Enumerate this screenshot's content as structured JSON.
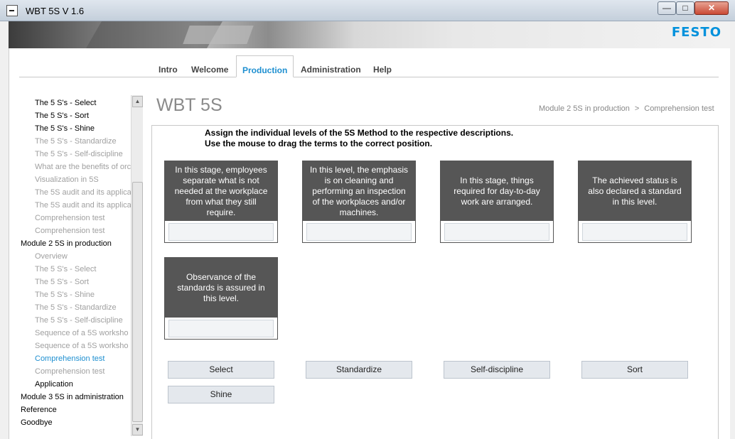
{
  "window": {
    "title": "WBT 5S  V 1.6",
    "minimize": "—",
    "maximize": "□",
    "close": "✕"
  },
  "banner": {
    "logo": "FESTO"
  },
  "tabs": [
    {
      "label": "Intro",
      "active": false
    },
    {
      "label": "Welcome",
      "active": false
    },
    {
      "label": "Production",
      "active": true
    },
    {
      "label": "Administration",
      "active": false
    },
    {
      "label": "Help",
      "active": false
    }
  ],
  "sidebar": {
    "items": [
      {
        "label": "The 5 S's - Select",
        "level": 1,
        "state": "dark"
      },
      {
        "label": "The 5 S's - Sort",
        "level": 1,
        "state": "dark"
      },
      {
        "label": "The 5 S's - Shine",
        "level": 1,
        "state": "dark"
      },
      {
        "label": "The 5 S's - Standardize",
        "level": 1,
        "state": "grey"
      },
      {
        "label": "The 5 S's - Self-discipline",
        "level": 1,
        "state": "grey"
      },
      {
        "label": "What are the benefits of orc",
        "level": 1,
        "state": "grey"
      },
      {
        "label": "Visualization in 5S",
        "level": 1,
        "state": "grey"
      },
      {
        "label": "The 5S audit and its applicat",
        "level": 1,
        "state": "grey"
      },
      {
        "label": "The 5S audit and its applicat",
        "level": 1,
        "state": "grey"
      },
      {
        "label": "Comprehension test",
        "level": 1,
        "state": "grey"
      },
      {
        "label": "Comprehension test",
        "level": 1,
        "state": "grey"
      },
      {
        "label": "Module 2 5S in production",
        "level": 0,
        "state": "dark"
      },
      {
        "label": "Overview",
        "level": 1,
        "state": "grey"
      },
      {
        "label": "The 5 S's - Select",
        "level": 1,
        "state": "grey"
      },
      {
        "label": "The 5 S's - Sort",
        "level": 1,
        "state": "grey"
      },
      {
        "label": "The 5 S's - Shine",
        "level": 1,
        "state": "grey"
      },
      {
        "label": "The 5 S's - Standardize",
        "level": 1,
        "state": "grey"
      },
      {
        "label": "The 5 S's - Self-discipline",
        "level": 1,
        "state": "grey"
      },
      {
        "label": "Sequence of a 5S worksho",
        "level": 1,
        "state": "grey"
      },
      {
        "label": "Sequence of a 5S worksho",
        "level": 1,
        "state": "grey"
      },
      {
        "label": "Comprehension test",
        "level": 1,
        "state": "blue"
      },
      {
        "label": "Comprehension test",
        "level": 1,
        "state": "grey"
      },
      {
        "label": "Application",
        "level": 1,
        "state": "dark"
      },
      {
        "label": "Module 3 5S in administration",
        "level": 0,
        "state": "dark"
      },
      {
        "label": "Reference",
        "level": 0,
        "state": "dark"
      },
      {
        "label": "Goodbye",
        "level": 0,
        "state": "dark"
      }
    ],
    "scroll_up": "▲",
    "scroll_down": "▼"
  },
  "main": {
    "title": "WBT 5S",
    "breadcrumb": [
      "Module 2 5S in production",
      "Comprehension test"
    ],
    "breadcrumb_sep": ">",
    "instructions": [
      "Assign the individual levels of the 5S Method to the respective descriptions.",
      "Use the mouse to drag the terms to the correct position."
    ],
    "descriptions": [
      "In this stage, employees separate what is not needed at the workplace from what they still require.",
      "In this level, the emphasis is on cleaning and performing an inspection of the workplaces and/or machines.",
      "In this stage, things required for day-to-day work are arranged.",
      "The achieved status is also declared a standard in this level.",
      "Observance of the standards is assured in this level."
    ],
    "terms": [
      "Select",
      "Standardize",
      "Self-discipline",
      "Sort",
      "Shine"
    ]
  },
  "colors": {
    "accent": "#1e8fd0",
    "card_bg": "#565656",
    "logo": "#0091dc"
  }
}
